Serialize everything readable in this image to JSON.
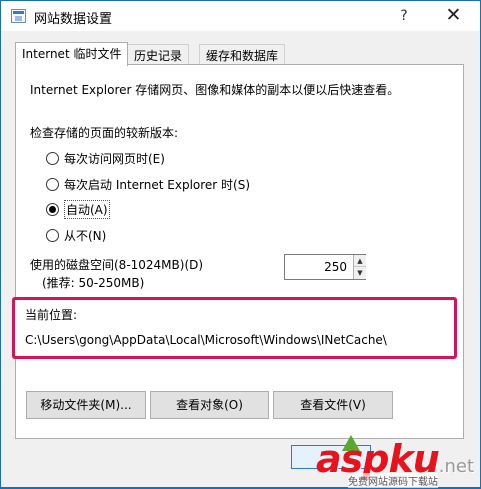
{
  "window": {
    "title": "网站数据设置",
    "help_label": "?",
    "close_label": "✕"
  },
  "tabs": [
    {
      "label": "Internet 临时文件",
      "active": true
    },
    {
      "label": "历史记录",
      "active": false
    },
    {
      "label": "缓存和数据库",
      "active": false
    }
  ],
  "panel": {
    "description": "Internet Explorer 存储网页、图像和媒体的副本以便以后快速查看。",
    "check_label": "检查存储的页面的较新版本:",
    "options": [
      {
        "label": "每次访问网页时(E)",
        "selected": false
      },
      {
        "label": "每次启动 Internet Explorer 时(S)",
        "selected": false
      },
      {
        "label": "自动(A)",
        "selected": true
      },
      {
        "label": "从不(N)",
        "selected": false
      }
    ],
    "disk_label": "使用的磁盘空间(8-1024MB)(D)",
    "disk_hint": "(推荐: 50-250MB)",
    "disk_value": "250",
    "location_label": "当前位置:",
    "location_path": "C:\\Users\\gong\\AppData\\Local\\Microsoft\\Windows\\INetCache\\",
    "buttons": {
      "move": "移动文件夹(M)...",
      "view_objects": "查看对象(O)",
      "view_files": "查看文件(V)"
    }
  },
  "watermark": {
    "logo": "aspku",
    "suffix": ".net",
    "subtitle": "免费网站源码下载站"
  },
  "colors": {
    "title_accent": "#1a6fb0",
    "highlight_border": "#d4145a",
    "watermark_red": "#e8111c",
    "watermark_green": "#5aa832"
  }
}
